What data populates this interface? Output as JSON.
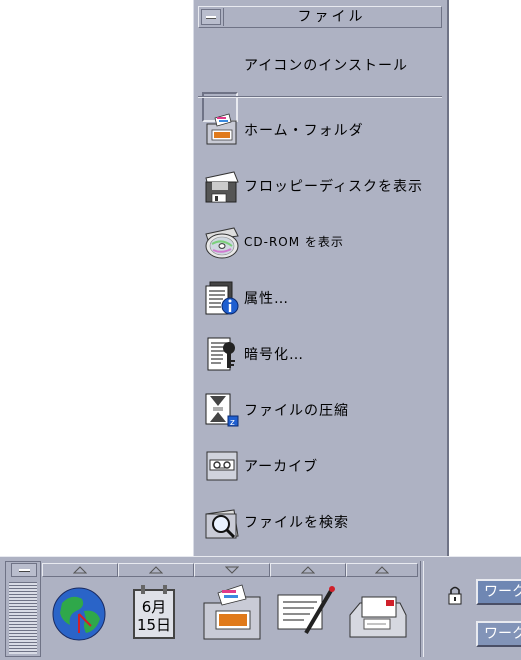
{
  "subpanel": {
    "title": "ファイル",
    "install_label": "アイコンのインストール",
    "items": [
      {
        "label": "ホーム・フォルダ",
        "icon": "home-folder-icon"
      },
      {
        "label": "フロッピーディスクを表示",
        "icon": "floppy-disk-icon"
      },
      {
        "label": "CD-ROM を表示",
        "icon": "cdrom-icon"
      },
      {
        "label": "属性…",
        "icon": "properties-icon"
      },
      {
        "label": "暗号化…",
        "icon": "encrypt-icon"
      },
      {
        "label": "ファイルの圧縮",
        "icon": "compress-icon"
      },
      {
        "label": "アーカイブ",
        "icon": "archive-icon"
      },
      {
        "label": "ファイルを検索",
        "icon": "find-file-icon"
      }
    ]
  },
  "frontpanel": {
    "calendar": {
      "month": "6月",
      "day": "15日"
    },
    "icons": [
      "globe-clock-icon",
      "calendar-icon",
      "file-manager-icon",
      "text-editor-icon",
      "mailer-icon"
    ],
    "workspaces": [
      {
        "label": "ワーク",
        "active": true
      },
      {
        "label": "ワーク",
        "active": false
      }
    ]
  },
  "colors": {
    "panel": "#aeb2c3",
    "workspace_active": "#6f87b3"
  }
}
